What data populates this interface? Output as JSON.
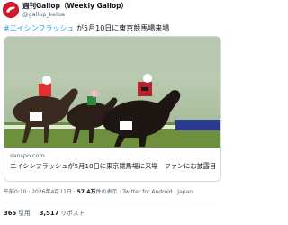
{
  "author": {
    "display_name": "週刊Gallop（Weekly Gallop）",
    "handle": "@gallop_keiba",
    "avatar_icon": "gallop-logo-icon",
    "avatar_color": "#d11a2a"
  },
  "tweet": {
    "hashtag": "#エイシンフラッシュ",
    "body": " が5月10日に東京競馬場来場"
  },
  "link_card": {
    "domain": "sanspo.com",
    "title": "エイシンフラッシュが5月10日に東京競馬場に来場　ファンにお披露目"
  },
  "meta": {
    "time": "午前0:10 · 2026年4月11日",
    "views_count": "57.4万",
    "views_label": "件の表示",
    "source": "Twitter for Android · Japan"
  },
  "stats": {
    "retweets_count": "365",
    "retweets_label": "引用",
    "likes_count": "3,517",
    "likes_label": "リポスト"
  },
  "colors": {
    "link": "#1d9bf0",
    "text": "#0f1419",
    "muted": "#536471"
  }
}
